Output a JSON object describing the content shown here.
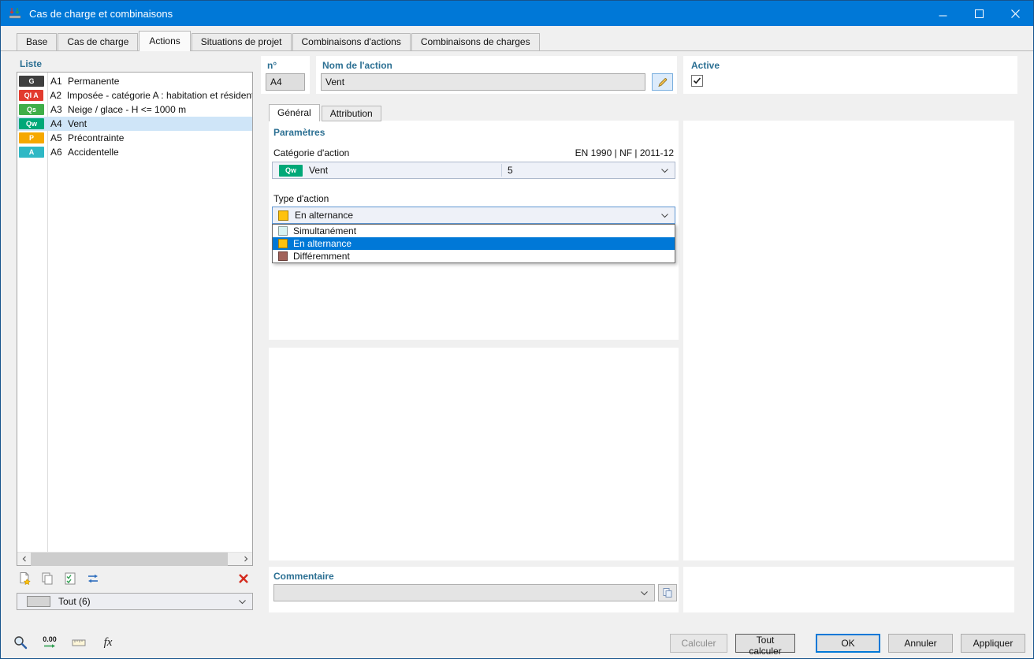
{
  "window": {
    "title": "Cas de charge et combinaisons"
  },
  "main_tabs": [
    {
      "label": "Base"
    },
    {
      "label": "Cas de charge"
    },
    {
      "label": "Actions"
    },
    {
      "label": "Situations de projet"
    },
    {
      "label": "Combinaisons d'actions"
    },
    {
      "label": "Combinaisons de charges"
    }
  ],
  "list": {
    "label": "Liste",
    "items": [
      {
        "badge": "G",
        "badge_color": "#3f3f3f",
        "id": "A1",
        "name": "Permanente"
      },
      {
        "badge": "QI A",
        "badge_color": "#e23b2e",
        "id": "A2",
        "name": "Imposée - catégorie A : habitation et résidenti"
      },
      {
        "badge": "Qs",
        "badge_color": "#3fae49",
        "id": "A3",
        "name": "Neige / glace - H <= 1000 m"
      },
      {
        "badge": "Qw",
        "badge_color": "#00a878",
        "id": "A4",
        "name": "Vent"
      },
      {
        "badge": "P",
        "badge_color": "#f6a800",
        "id": "A5",
        "name": "Précontrainte"
      },
      {
        "badge": "A",
        "badge_color": "#2fb8c5",
        "id": "A6",
        "name": "Accidentelle"
      }
    ],
    "filter_value": "Tout (6)"
  },
  "header": {
    "number_label": "n°",
    "number_value": "A4",
    "name_label": "Nom de l'action",
    "name_value": "Vent",
    "active_label": "Active",
    "active_checked": true
  },
  "detail_tabs": [
    {
      "label": "Général"
    },
    {
      "label": "Attribution"
    }
  ],
  "parameters": {
    "section_label": "Paramètres",
    "category_label": "Catégorie d'action",
    "code_reference": "EN 1990 | NF | 2011-12",
    "category_badge": "Qw",
    "category_badge_color": "#00a878",
    "category_name": "Vent",
    "category_number": "5",
    "type_label": "Type d'action",
    "type_value": "En alternance",
    "type_value_color": "#ffc20e",
    "type_options": [
      {
        "label": "Simultanément",
        "color": "#d9f3f1",
        "selected": false
      },
      {
        "label": "En alternance",
        "color": "#ffc20e",
        "selected": true
      },
      {
        "label": "Différemment",
        "color": "#a2625a",
        "selected": false
      }
    ]
  },
  "comment": {
    "label": "Commentaire",
    "value": ""
  },
  "footer": {
    "tools": {
      "decimal_label": "0.00",
      "fx_label": "fx"
    },
    "buttons": [
      {
        "label": "Calculer",
        "disabled": true
      },
      {
        "label": "Tout calculer"
      },
      {
        "label": "OK",
        "default": true
      },
      {
        "label": "Annuler"
      },
      {
        "label": "Appliquer"
      }
    ]
  },
  "icons": [
    "app-icon",
    "minimize-icon",
    "maximize-icon",
    "close-icon",
    "new-action-icon",
    "copy-action-icon",
    "transfer-check-icon",
    "renumber-icon",
    "delete-x-icon",
    "scroll-left-icon",
    "scroll-right-icon",
    "chevron-down-icon",
    "edit-pencil-icon",
    "checkbox-check-icon",
    "magnifier-icon",
    "decimal-places-icon",
    "units-icon",
    "function-fx-icon",
    "comment-options-icon",
    "filter-color-swatch"
  ]
}
